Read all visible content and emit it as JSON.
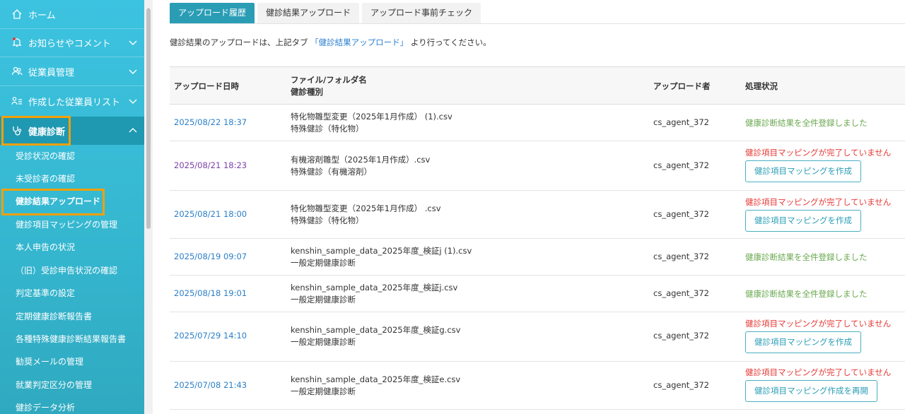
{
  "sidebar": {
    "items": [
      {
        "label": "ホーム",
        "icon": "home-icon"
      },
      {
        "label": "お知らせやコメント",
        "icon": "bell-icon"
      },
      {
        "label": "従業員管理",
        "icon": "users-icon"
      },
      {
        "label": "作成した従業員リスト",
        "icon": "list-user-icon"
      },
      {
        "label": "健康診断",
        "icon": "stethoscope-icon"
      }
    ],
    "subitems": [
      "受診状況の確認",
      "未受診者の確認",
      "健診結果アップロード",
      "健診項目マッピングの管理",
      "本人申告の状況",
      "（旧）受診申告状況の確認",
      "判定基準の設定",
      "定期健康診断報告書",
      "各種特殊健康診断結果報告書",
      "勧奨メールの管理",
      "就業判定区分の管理",
      "健診データ分析"
    ]
  },
  "tabs": [
    "アップロード履歴",
    "健診結果アップロード",
    "アップロード事前チェック"
  ],
  "notice": {
    "before": "健診結果のアップロードは、上記タブ",
    "link": "「健診結果アップロード」",
    "after": "より行ってください。"
  },
  "table": {
    "headers": {
      "date": "アップロード日時",
      "file": "ファイル/フォルダ名",
      "type": "健診種別",
      "uploader": "アップロード者",
      "status": "処理状況"
    },
    "rows": [
      {
        "date": "2025/08/22 18:37",
        "file": "特化物雛型変更（2025年1月作成） (1).csv",
        "type": "特殊健診（特化物）",
        "uploader": "cs_agent_372",
        "status": "健康診断結果を全件登録しました",
        "ok": true,
        "button": ""
      },
      {
        "date": "2025/08/21 18:23",
        "file": "有機溶剤雛型（2025年1月作成）.csv",
        "type": "特殊健診（有機溶剤）",
        "uploader": "cs_agent_372",
        "status": "健診項目マッピングが完了していません",
        "ok": false,
        "button": "健診項目マッピングを作成"
      },
      {
        "date": "2025/08/21 18:00",
        "file": "特化物雛型変更（2025年1月作成） .csv",
        "type": "特殊健診（特化物）",
        "uploader": "cs_agent_372",
        "status": "健診項目マッピングが完了していません",
        "ok": false,
        "button": "健診項目マッピングを作成"
      },
      {
        "date": "2025/08/19 09:07",
        "file": "kenshin_sample_data_2025年度_検証j (1).csv",
        "type": "一般定期健康診断",
        "uploader": "cs_agent_372",
        "status": "健康診断結果を全件登録しました",
        "ok": true,
        "button": ""
      },
      {
        "date": "2025/08/18 19:01",
        "file": "kenshin_sample_data_2025年度_検証j.csv",
        "type": "一般定期健康診断",
        "uploader": "cs_agent_372",
        "status": "健康診断結果を全件登録しました",
        "ok": true,
        "button": ""
      },
      {
        "date": "2025/07/29 14:10",
        "file": "kenshin_sample_data_2025年度_検証g.csv",
        "type": "一般定期健康診断",
        "uploader": "cs_agent_372",
        "status": "健診項目マッピングが完了していません",
        "ok": false,
        "button": "健診項目マッピングを作成"
      },
      {
        "date": "2025/07/08 21:43",
        "file": "kenshin_sample_data_2025年度_検証e.csv",
        "type": "一般定期健康診断",
        "uploader": "cs_agent_372",
        "status": "健診項目マッピングが完了していません",
        "ok": false,
        "button": "健診項目マッピング作成を再開"
      }
    ]
  },
  "colors": {
    "sidebar": "#35b6cf",
    "active_tab": "#2a9db5",
    "link": "#2a7fc8",
    "visited": "#7b3fa8",
    "ok": "#6aa84f",
    "error": "#e53935",
    "highlight": "#f5a000"
  }
}
